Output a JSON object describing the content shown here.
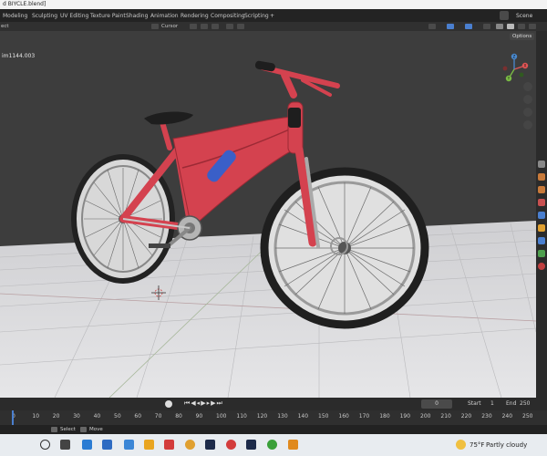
{
  "window": {
    "title": "d BIYCLE.blend]"
  },
  "workspace_tabs": [
    "Modeling",
    "Sculpting",
    "UV Editing",
    "Texture Paint",
    "Shading",
    "Animation",
    "Rendering",
    "Compositing",
    "Scripting"
  ],
  "workspace_add": "+",
  "scene_label": "Scene",
  "viewport_header": {
    "left_label": "ect",
    "transform_pivot": "Cursor",
    "options": "Options"
  },
  "viewport": {
    "object_info": "im1144.003"
  },
  "navigation_gizmo": {
    "x_label": "X",
    "y_label": "Y",
    "z_label": "Z"
  },
  "timeline": {
    "current_frame": "0",
    "start_label": "Start",
    "start_value": "1",
    "end_label": "End",
    "end_value": "250",
    "ruler_ticks": [
      "0",
      "10",
      "20",
      "30",
      "40",
      "50",
      "60",
      "70",
      "80",
      "90",
      "100",
      "110",
      "120",
      "130",
      "140",
      "150",
      "160",
      "170",
      "180",
      "190",
      "200",
      "210",
      "220",
      "230",
      "240",
      "250"
    ]
  },
  "status_bar": {
    "select_label": "Select",
    "move_label": "Move"
  },
  "taskbar": {
    "weather_temp": "75°F",
    "weather_text": "Partly cloudy"
  },
  "colors": {
    "bike_frame": "#d4424f",
    "bike_frame_dark": "#9c2a35",
    "tire": "#2a2a2a",
    "bottle": "#3a5fc8",
    "accent_blue": "#4a7fcf"
  }
}
